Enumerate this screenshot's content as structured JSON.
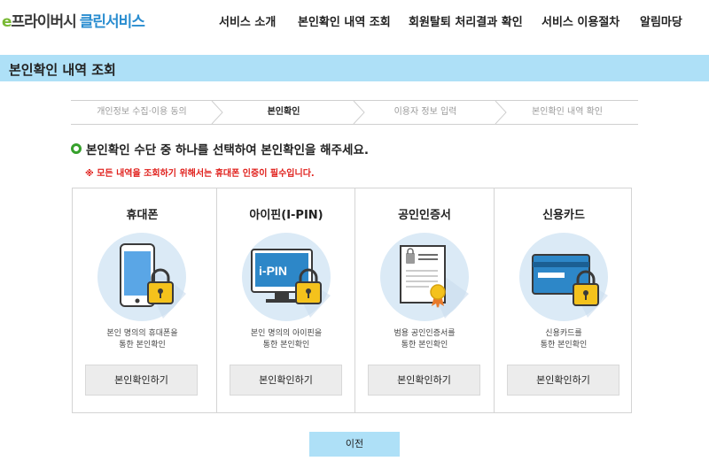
{
  "header": {
    "logo_e": "e",
    "logo_main": "프라이버시",
    "logo_clean": "클린서비스",
    "nav": [
      "서비스 소개",
      "본인확인 내역 조회",
      "회원탈퇴 처리결과 확인",
      "서비스 이용절차",
      "알림마당"
    ]
  },
  "page_title": "본인확인 내역 조회",
  "steps": [
    "개인정보 수집·이용 동의",
    "본인확인",
    "이용자 정보 입력",
    "본인확인 내역 확인"
  ],
  "active_step": 1,
  "instruction": "본인확인 수단 중 하나를 선택하여 본인확인을 해주세요.",
  "notice": "※ 모든 내역을 조회하기 위해서는 휴대폰 인증이 필수입니다.",
  "cards": [
    {
      "title": "휴대폰",
      "desc1": "본인 명의의 휴대폰을",
      "desc2": "통한 본인확인",
      "button": "본인확인하기",
      "icon": "mobile-phone-lock-icon"
    },
    {
      "title": "아이핀(I-PIN)",
      "desc1": "본인 명의의 아이핀을",
      "desc2": "통한 본인확인",
      "button": "본인확인하기",
      "icon": "ipin-monitor-lock-icon",
      "icon_text": "i-PIN"
    },
    {
      "title": "공인인증서",
      "desc1": "범용 공인인증서를",
      "desc2": "통한 본인확인",
      "button": "본인확인하기",
      "icon": "certificate-icon"
    },
    {
      "title": "신용카드",
      "desc1": "신용카드를",
      "desc2": "통한 본인확인",
      "button": "본인확인하기",
      "icon": "credit-card-lock-icon"
    }
  ],
  "prev_button": "이전",
  "colors": {
    "title_bar": "#aee0f7",
    "accent_green": "#36a02c",
    "notice_red": "#e0201c",
    "logo_blue": "#2a8dd0",
    "logo_green": "#79b935",
    "icon_circle": "#dbeaf6",
    "lock_yellow": "#f4c21c"
  }
}
